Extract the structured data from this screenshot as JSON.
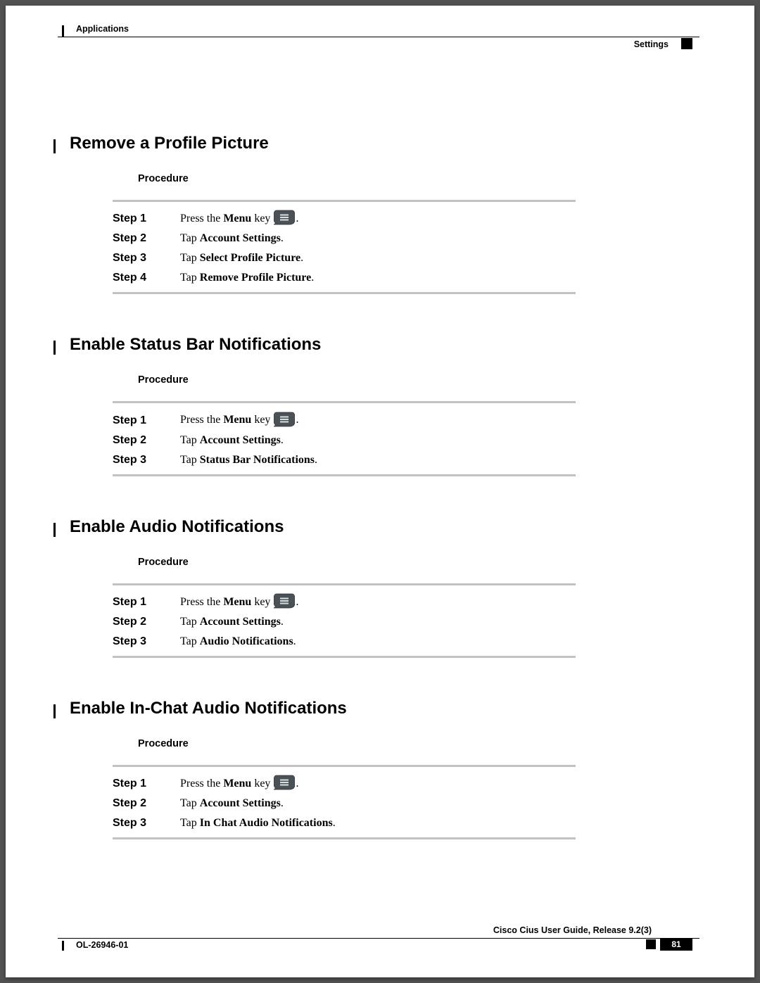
{
  "header": {
    "applications": "Applications",
    "settings": "Settings"
  },
  "sections": [
    {
      "title": "Remove a Profile Picture",
      "procedure_label": "Procedure",
      "steps": [
        {
          "num": "Step 1",
          "pre": "Press the ",
          "bold": "Menu",
          "post": " key ",
          "icon": true,
          "tail": "."
        },
        {
          "num": "Step 2",
          "pre": "Tap ",
          "bold": "Account Settings",
          "post": ".",
          "icon": false,
          "tail": ""
        },
        {
          "num": "Step 3",
          "pre": "Tap ",
          "bold": "Select Profile Picture",
          "post": ".",
          "icon": false,
          "tail": ""
        },
        {
          "num": "Step 4",
          "pre": "Tap ",
          "bold": "Remove Profile Picture",
          "post": ".",
          "icon": false,
          "tail": ""
        }
      ]
    },
    {
      "title": "Enable Status Bar Notifications",
      "procedure_label": "Procedure",
      "steps": [
        {
          "num": "Step 1",
          "pre": "Press the ",
          "bold": "Menu",
          "post": " key ",
          "icon": true,
          "tail": "."
        },
        {
          "num": "Step 2",
          "pre": "Tap ",
          "bold": "Account Settings",
          "post": ".",
          "icon": false,
          "tail": ""
        },
        {
          "num": "Step 3",
          "pre": "Tap ",
          "bold": "Status Bar Notifications",
          "post": ".",
          "icon": false,
          "tail": ""
        }
      ]
    },
    {
      "title": "Enable Audio Notifications",
      "procedure_label": "Procedure",
      "steps": [
        {
          "num": "Step 1",
          "pre": "Press the ",
          "bold": "Menu",
          "post": " key ",
          "icon": true,
          "tail": "."
        },
        {
          "num": "Step 2",
          "pre": "Tap ",
          "bold": "Account Settings",
          "post": ".",
          "icon": false,
          "tail": ""
        },
        {
          "num": "Step 3",
          "pre": "Tap ",
          "bold": "Audio Notifications",
          "post": ".",
          "icon": false,
          "tail": ""
        }
      ]
    },
    {
      "title": "Enable In-Chat Audio Notifications",
      "procedure_label": "Procedure",
      "steps": [
        {
          "num": "Step 1",
          "pre": "Press the ",
          "bold": "Menu",
          "post": " key ",
          "icon": true,
          "tail": "."
        },
        {
          "num": "Step 2",
          "pre": "Tap ",
          "bold": "Account Settings",
          "post": ".",
          "icon": false,
          "tail": ""
        },
        {
          "num": "Step 3",
          "pre": "Tap ",
          "bold": "In Chat Audio Notifications",
          "post": ".",
          "icon": false,
          "tail": ""
        }
      ]
    }
  ],
  "footer": {
    "guide": "Cisco Cius User Guide, Release 9.2(3)",
    "doc_number": "OL-26946-01",
    "page": "81"
  }
}
